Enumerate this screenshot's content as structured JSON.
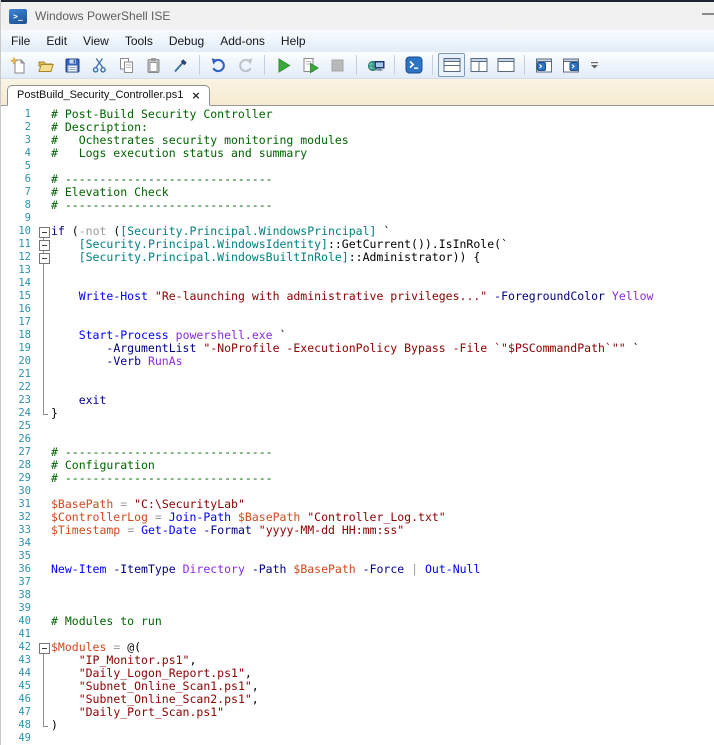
{
  "window": {
    "title": "Windows PowerShell ISE",
    "accent_color": "#2D74C4",
    "chrome_background": "#F1F1F1",
    "tabstrip_background": "#FBF4E4"
  },
  "menu": {
    "items": [
      "File",
      "Edit",
      "View",
      "Tools",
      "Debug",
      "Add-ons",
      "Help"
    ]
  },
  "toolbar": {
    "buttons": [
      {
        "name": "new-script",
        "enabled": true
      },
      {
        "name": "open-script",
        "enabled": true
      },
      {
        "name": "save-script",
        "enabled": true
      },
      {
        "name": "cut",
        "enabled": true
      },
      {
        "name": "copy",
        "enabled": true
      },
      {
        "name": "paste",
        "enabled": true
      },
      {
        "name": "clear-console-pane",
        "enabled": true
      },
      {
        "name": "undo",
        "enabled": true
      },
      {
        "name": "redo",
        "enabled": false
      },
      {
        "name": "run-script",
        "enabled": true
      },
      {
        "name": "run-selection",
        "enabled": true
      },
      {
        "name": "stop-operation",
        "enabled": false
      },
      {
        "name": "new-remote-powershell-tab",
        "enabled": true
      },
      {
        "name": "start-powershell-exe",
        "enabled": true
      },
      {
        "name": "show-script-pane-top",
        "enabled": true,
        "selected": true
      },
      {
        "name": "show-script-pane-right",
        "enabled": true
      },
      {
        "name": "show-script-pane-maximized",
        "enabled": true
      },
      {
        "name": "new-powershell-tab",
        "enabled": true
      },
      {
        "name": "new-powershell-window",
        "enabled": true
      },
      {
        "name": "toolbar-overflow",
        "enabled": true
      }
    ]
  },
  "tabs": [
    {
      "label": "PostBuild_Security_Controller.ps1",
      "active": true,
      "close_glyph": "×"
    }
  ],
  "editor": {
    "line_number_color": "#2B91AF",
    "syntax_colors": {
      "comment": "#006400",
      "keyword": "#00008B",
      "cmdlet": "#0000FF",
      "parameter": "#000080",
      "argument": "#8A2BE2",
      "string": "#8B0000",
      "variable": "#CE4A1C",
      "type": "#008080",
      "operator": "#9B9B9B",
      "plain": "#000000"
    },
    "lines": [
      {
        "n": 1,
        "fold": "",
        "segs": [
          [
            "comment",
            "# Post-Build Security Controller"
          ]
        ]
      },
      {
        "n": 2,
        "fold": "",
        "segs": [
          [
            "comment",
            "# Description:"
          ]
        ]
      },
      {
        "n": 3,
        "fold": "",
        "segs": [
          [
            "comment",
            "#   Ochestrates security monitoring modules"
          ]
        ]
      },
      {
        "n": 4,
        "fold": "",
        "segs": [
          [
            "comment",
            "#   Logs execution status and summary"
          ]
        ]
      },
      {
        "n": 5,
        "fold": "",
        "segs": []
      },
      {
        "n": 6,
        "fold": "",
        "segs": [
          [
            "comment",
            "# ------------------------------"
          ]
        ]
      },
      {
        "n": 7,
        "fold": "",
        "segs": [
          [
            "comment",
            "# Elevation Check"
          ]
        ]
      },
      {
        "n": 8,
        "fold": "",
        "segs": [
          [
            "comment",
            "# ------------------------------"
          ]
        ]
      },
      {
        "n": 9,
        "fold": "",
        "segs": []
      },
      {
        "n": 10,
        "fold": "box-first",
        "segs": [
          [
            "keyword",
            "if"
          ],
          [
            "plain",
            " ("
          ],
          [
            "op",
            "-not"
          ],
          [
            "plain",
            " ("
          ],
          [
            "type",
            "[Security.Principal.WindowsPrincipal]"
          ],
          [
            "plain",
            " `"
          ]
        ]
      },
      {
        "n": 11,
        "fold": "box-mid",
        "segs": [
          [
            "plain",
            "    "
          ],
          [
            "type",
            "[Security.Principal.WindowsIdentity]"
          ],
          [
            "plain",
            "::GetCurrent()).IsInRole(`"
          ]
        ]
      },
      {
        "n": 12,
        "fold": "box-mid",
        "segs": [
          [
            "plain",
            "    "
          ],
          [
            "type",
            "[Security.Principal.WindowsBuiltInRole]"
          ],
          [
            "plain",
            "::Administrator)) {"
          ]
        ]
      },
      {
        "n": 13,
        "fold": "line",
        "segs": []
      },
      {
        "n": 14,
        "fold": "line",
        "segs": []
      },
      {
        "n": 15,
        "fold": "line",
        "segs": [
          [
            "plain",
            "    "
          ],
          [
            "cmdlet",
            "Write-Host"
          ],
          [
            "plain",
            " "
          ],
          [
            "string",
            "\"Re-launching with administrative privileges...\""
          ],
          [
            "plain",
            " "
          ],
          [
            "param",
            "-ForegroundColor"
          ],
          [
            "plain",
            " "
          ],
          [
            "arg",
            "Yellow"
          ]
        ]
      },
      {
        "n": 16,
        "fold": "line",
        "segs": []
      },
      {
        "n": 17,
        "fold": "line",
        "segs": []
      },
      {
        "n": 18,
        "fold": "line",
        "segs": [
          [
            "plain",
            "    "
          ],
          [
            "cmdlet",
            "Start-Process"
          ],
          [
            "plain",
            " "
          ],
          [
            "arg",
            "powershell.exe"
          ],
          [
            "plain",
            " `"
          ]
        ]
      },
      {
        "n": 19,
        "fold": "line",
        "segs": [
          [
            "plain",
            "        "
          ],
          [
            "param",
            "-ArgumentList"
          ],
          [
            "plain",
            " "
          ],
          [
            "string",
            "\"-NoProfile -ExecutionPolicy Bypass -File `\"$PSCommandPath`\"\""
          ],
          [
            "plain",
            " `"
          ]
        ]
      },
      {
        "n": 20,
        "fold": "line",
        "segs": [
          [
            "plain",
            "        "
          ],
          [
            "param",
            "-Verb"
          ],
          [
            "plain",
            " "
          ],
          [
            "arg",
            "RunAs"
          ]
        ]
      },
      {
        "n": 21,
        "fold": "line",
        "segs": []
      },
      {
        "n": 22,
        "fold": "line",
        "segs": []
      },
      {
        "n": 23,
        "fold": "line",
        "segs": [
          [
            "plain",
            "    "
          ],
          [
            "keyword",
            "exit"
          ]
        ]
      },
      {
        "n": 24,
        "fold": "end",
        "segs": [
          [
            "plain",
            "}"
          ]
        ]
      },
      {
        "n": 25,
        "fold": "",
        "segs": []
      },
      {
        "n": 26,
        "fold": "",
        "segs": []
      },
      {
        "n": 27,
        "fold": "",
        "segs": [
          [
            "comment",
            "# ------------------------------"
          ]
        ]
      },
      {
        "n": 28,
        "fold": "",
        "segs": [
          [
            "comment",
            "# Configuration"
          ]
        ]
      },
      {
        "n": 29,
        "fold": "",
        "segs": [
          [
            "comment",
            "# ------------------------------"
          ]
        ]
      },
      {
        "n": 30,
        "fold": "",
        "segs": []
      },
      {
        "n": 31,
        "fold": "",
        "segs": [
          [
            "variable",
            "$BasePath"
          ],
          [
            "plain",
            " "
          ],
          [
            "op",
            "="
          ],
          [
            "plain",
            " "
          ],
          [
            "string",
            "\"C:\\SecurityLab\""
          ]
        ]
      },
      {
        "n": 32,
        "fold": "",
        "segs": [
          [
            "variable",
            "$ControllerLog"
          ],
          [
            "plain",
            " "
          ],
          [
            "op",
            "="
          ],
          [
            "plain",
            " "
          ],
          [
            "cmdlet",
            "Join-Path"
          ],
          [
            "plain",
            " "
          ],
          [
            "variable",
            "$BasePath"
          ],
          [
            "plain",
            " "
          ],
          [
            "string",
            "\"Controller_Log.txt\""
          ]
        ]
      },
      {
        "n": 33,
        "fold": "",
        "segs": [
          [
            "variable",
            "$Timestamp"
          ],
          [
            "plain",
            " "
          ],
          [
            "op",
            "="
          ],
          [
            "plain",
            " "
          ],
          [
            "cmdlet",
            "Get-Date"
          ],
          [
            "plain",
            " "
          ],
          [
            "param",
            "-Format"
          ],
          [
            "plain",
            " "
          ],
          [
            "string",
            "\"yyyy-MM-dd HH:mm:ss\""
          ]
        ]
      },
      {
        "n": 34,
        "fold": "",
        "segs": []
      },
      {
        "n": 35,
        "fold": "",
        "segs": []
      },
      {
        "n": 36,
        "fold": "",
        "segs": [
          [
            "cmdlet",
            "New-Item"
          ],
          [
            "plain",
            " "
          ],
          [
            "param",
            "-ItemType"
          ],
          [
            "plain",
            " "
          ],
          [
            "arg",
            "Directory"
          ],
          [
            "plain",
            " "
          ],
          [
            "param",
            "-Path"
          ],
          [
            "plain",
            " "
          ],
          [
            "variable",
            "$BasePath"
          ],
          [
            "plain",
            " "
          ],
          [
            "param",
            "-Force"
          ],
          [
            "plain",
            " "
          ],
          [
            "op",
            "|"
          ],
          [
            "plain",
            " "
          ],
          [
            "cmdlet",
            "Out-Null"
          ]
        ]
      },
      {
        "n": 37,
        "fold": "",
        "segs": []
      },
      {
        "n": 38,
        "fold": "",
        "segs": []
      },
      {
        "n": 39,
        "fold": "",
        "segs": []
      },
      {
        "n": 40,
        "fold": "",
        "segs": [
          [
            "comment",
            "# Modules to run"
          ]
        ]
      },
      {
        "n": 41,
        "fold": "",
        "segs": []
      },
      {
        "n": 42,
        "fold": "box-first",
        "segs": [
          [
            "variable",
            "$Modules"
          ],
          [
            "plain",
            " "
          ],
          [
            "op",
            "="
          ],
          [
            "plain",
            " "
          ],
          [
            "plain",
            "@("
          ]
        ]
      },
      {
        "n": 43,
        "fold": "line",
        "segs": [
          [
            "plain",
            "    "
          ],
          [
            "string",
            "\"IP_Monitor.ps1\""
          ],
          [
            "plain",
            ","
          ]
        ]
      },
      {
        "n": 44,
        "fold": "line",
        "segs": [
          [
            "plain",
            "    "
          ],
          [
            "string",
            "\"Daily_Logon_Report.ps1\""
          ],
          [
            "plain",
            ","
          ]
        ]
      },
      {
        "n": 45,
        "fold": "line",
        "segs": [
          [
            "plain",
            "    "
          ],
          [
            "string",
            "\"Subnet_Online_Scan1.ps1\""
          ],
          [
            "plain",
            ","
          ]
        ]
      },
      {
        "n": 46,
        "fold": "line",
        "segs": [
          [
            "plain",
            "    "
          ],
          [
            "string",
            "\"Subnet_Online_Scan2.ps1\""
          ],
          [
            "plain",
            ","
          ]
        ]
      },
      {
        "n": 47,
        "fold": "line",
        "segs": [
          [
            "plain",
            "    "
          ],
          [
            "string",
            "\"Daily_Port_Scan.ps1\""
          ]
        ]
      },
      {
        "n": 48,
        "fold": "end",
        "segs": [
          [
            "plain",
            ")"
          ]
        ]
      },
      {
        "n": 49,
        "fold": "",
        "segs": []
      }
    ]
  }
}
